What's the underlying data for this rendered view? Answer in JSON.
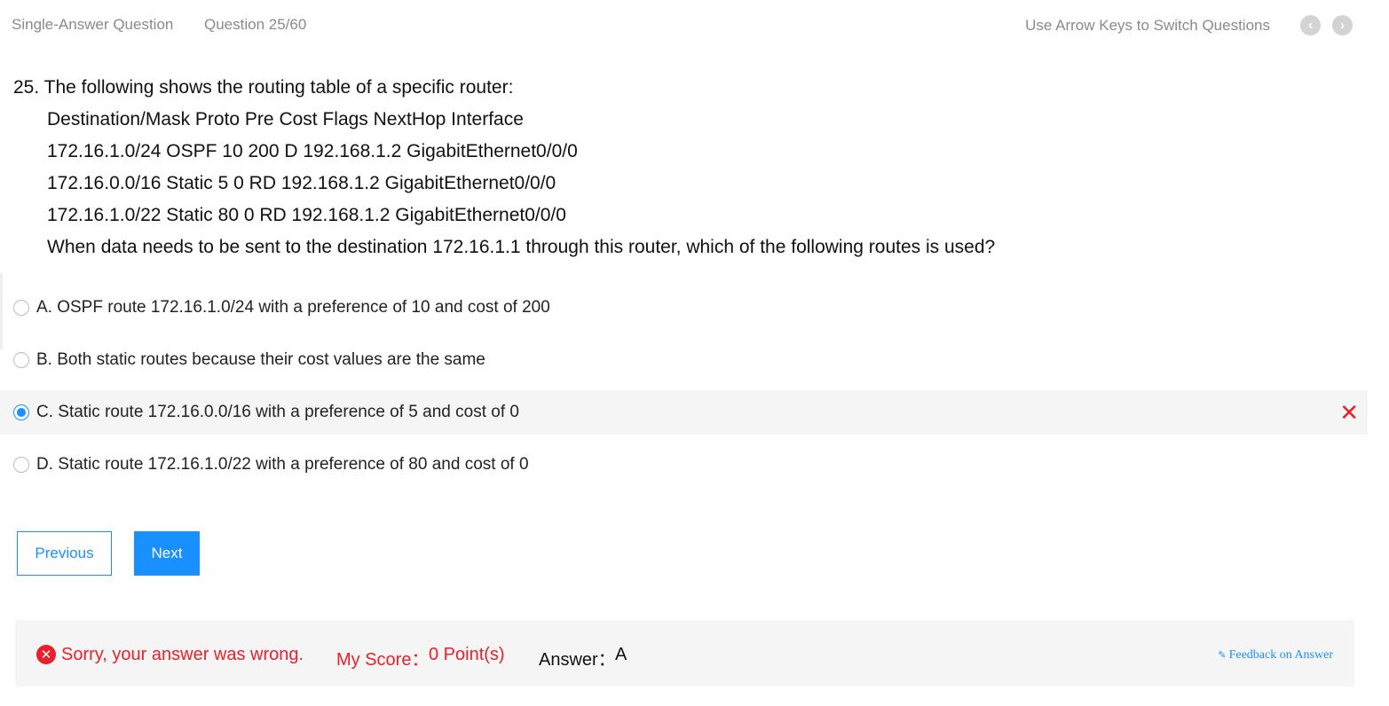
{
  "header": {
    "question_type": "Single-Answer Question",
    "question_counter": "Question 25/60",
    "hint": "Use Arrow Keys to Switch Questions",
    "prev_icon": "chevron-left-icon",
    "next_icon": "chevron-right-icon"
  },
  "question": {
    "title": "25. The following shows the routing table of a specific router:",
    "lines": [
      "Destination/Mask Proto Pre Cost Flags NextHop Interface",
      "172.16.1.0/24 OSPF 10 200 D 192.168.1.2 GigabitEthernet0/0/0",
      "172.16.0.0/16 Static 5 0 RD 192.168.1.2 GigabitEthernet0/0/0",
      "172.16.1.0/22 Static 80 0 RD 192.168.1.2 GigabitEthernet0/0/0",
      "When data needs to be sent to the destination 172.16.1.1 through this router, which of the following routes is used?"
    ]
  },
  "options": [
    {
      "label": "A. OSPF route 172.16.1.0/24 with a preference of 10 and cost of 200",
      "selected": false
    },
    {
      "label": "B. Both static routes because their cost values are the same",
      "selected": false
    },
    {
      "label": "C. Static route 172.16.0.0/16 with a preference of 5 and cost of 0",
      "selected": true,
      "wrong_mark": "✕"
    },
    {
      "label": "D. Static route 172.16.1.0/22 with a preference of 80 and cost of 0",
      "selected": false
    }
  ],
  "buttons": {
    "previous": "Previous",
    "next": "Next"
  },
  "result": {
    "message": "Sorry, your answer was wrong.",
    "score_label": "My Score：",
    "score_value": "0 Point(s)",
    "answer_label": "Answer：",
    "answer_value": "A",
    "feedback": "Feedback on Answer"
  },
  "colors": {
    "accent": "#1890ff",
    "error": "#e8212c",
    "muted": "#8a8a8a"
  }
}
